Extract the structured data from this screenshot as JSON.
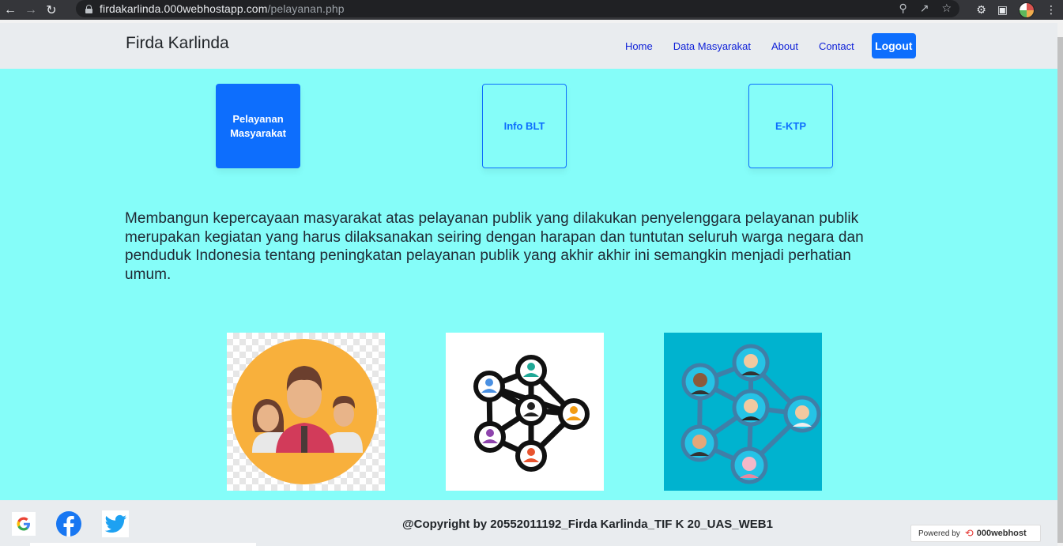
{
  "browser": {
    "url_host": "firdakarlinda.000webhostapp.com",
    "url_path": "/pelayanan.php",
    "icons": [
      "back-icon",
      "forward-icon",
      "reload-icon",
      "lock-icon",
      "zoom-icon",
      "share-icon",
      "star-icon",
      "extensions-icon",
      "sidepanel-icon",
      "profile-avatar",
      "menu-icon"
    ]
  },
  "navbar": {
    "brand": "Firda Karlinda",
    "links": [
      "Home",
      "Data Masyarakat",
      "About",
      "Contact"
    ],
    "logout_label": "Logout"
  },
  "cards": [
    {
      "label": "Pelayanan Masyarakat",
      "active": true
    },
    {
      "label": "Info BLT",
      "active": false
    },
    {
      "label": "E-KTP",
      "active": false
    }
  ],
  "intro_text": "Membangun kepercayaan masyarakat atas pelayanan publik yang dilakukan penyelenggara pelayanan publik merupakan kegiatan yang harus dilaksanakan seiring dengan harapan dan tuntutan seluruh warga negara dan penduduk Indonesia tentang peningkatan pelayanan publik yang akhir akhir ini semangkin menjadi perhatian umum.",
  "images": [
    "people-group-illustration",
    "network-people-icon",
    "social-network-illustration"
  ],
  "footer": {
    "social_icons": [
      "google-icon",
      "facebook-icon",
      "twitter-icon"
    ],
    "copyright": "@Copyright by 20552011192_Firda Karlinda_TIF K 20_UAS_WEB1",
    "powered_label": "Powered by",
    "powered_brand": "000webhost"
  },
  "colors": {
    "primary": "#0d6efd",
    "main_bg": "#85fdf9",
    "navbar_bg": "#e9ecef"
  }
}
